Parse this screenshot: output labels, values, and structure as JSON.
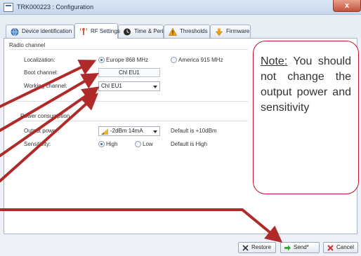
{
  "window": {
    "title": "TRK000223 : Configuration",
    "close_label": "x"
  },
  "tabs": [
    {
      "label": "Device identification",
      "icon": "globe-icon"
    },
    {
      "label": "RF Settings",
      "icon": "antenna-icon",
      "active": true
    },
    {
      "label": "Time & Period",
      "icon": "clock-icon"
    },
    {
      "label": "Thresholds",
      "icon": "warning-icon"
    },
    {
      "label": "Firmware",
      "icon": "download-icon"
    }
  ],
  "radio_channel": {
    "section_title": "Radio channel",
    "localization_label": "Localization:",
    "option_europe": "Europe 868 MHz",
    "option_america": "America 915 MHz",
    "selected": "Europe 868 MHz",
    "boot_channel_label": "Boot channel:",
    "boot_channel_value": "Chl EU1",
    "working_channel_label": "Working channel:",
    "working_channel_value": "Chl EU1"
  },
  "power_consumption": {
    "section_title": "Power consumption",
    "output_power_label": "Output power:",
    "output_power_value": "-2dBm 14mA",
    "output_power_default": "Default is +10dBm",
    "sensitivity_label": "Sensitivity:",
    "option_high": "High",
    "option_low": "Low",
    "selected": "High",
    "sensitivity_default": "Default is High"
  },
  "buttons": {
    "restore": "Restore",
    "send": "Send*",
    "cancel": "Cancel"
  },
  "note": {
    "heading": "Note:",
    "text": "You should not change the output power and sensitivity"
  },
  "colors": {
    "arrow": "#b02a2a",
    "note_border": "#c8102e",
    "accent": "#2d6fc4"
  }
}
